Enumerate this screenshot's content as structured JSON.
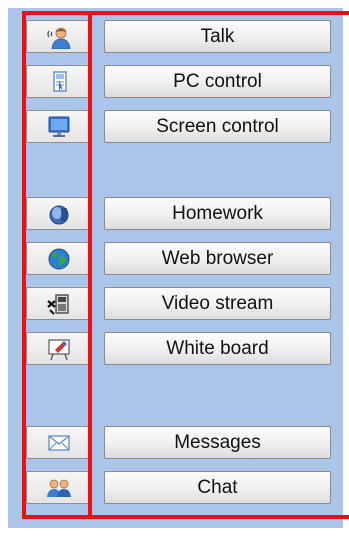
{
  "toolbar": {
    "items": [
      {
        "label": "Talk",
        "icon": "talk-icon"
      },
      {
        "label": "PC control",
        "icon": "pc-control-icon"
      },
      {
        "label": "Screen control",
        "icon": "screen-control-icon"
      },
      {
        "label": "Homework",
        "icon": "homework-icon"
      },
      {
        "label": "Web browser",
        "icon": "web-browser-icon"
      },
      {
        "label": "Video stream",
        "icon": "video-stream-icon"
      },
      {
        "label": "White board",
        "icon": "white-board-icon"
      },
      {
        "label": "Messages",
        "icon": "messages-icon"
      },
      {
        "label": "Chat",
        "icon": "chat-icon"
      }
    ]
  },
  "colors": {
    "panel_background": "#aac5e9",
    "highlight_outline": "#ee1010"
  }
}
